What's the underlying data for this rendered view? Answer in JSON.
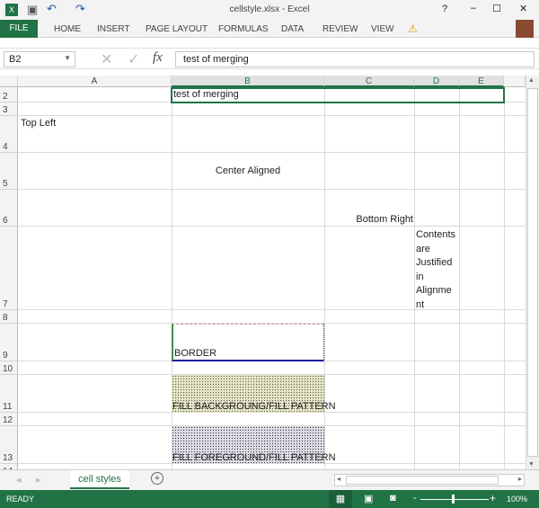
{
  "window": {
    "title": "cellstyle.xlsx - Excel",
    "help": "?",
    "minimize": "–",
    "maximize": "☐",
    "close": "✕"
  },
  "ribbon": {
    "tabs": [
      "FILE",
      "HOME",
      "INSERT",
      "PAGE LAYOUT",
      "FORMULAS",
      "DATA",
      "REVIEW",
      "VIEW"
    ],
    "warning": "⚠"
  },
  "formula_bar": {
    "name_box": "B2",
    "fx": "fx",
    "value": "test of merging"
  },
  "columns": [
    "A",
    "B",
    "C",
    "D",
    "E"
  ],
  "rows": [
    "2",
    "3",
    "4",
    "5",
    "6",
    "7",
    "8",
    "9",
    "10",
    "11",
    "12",
    "13",
    "14"
  ],
  "cells": {
    "B2": "test of merging",
    "A4": "Top Left",
    "B5": "Center Aligned",
    "C6": "Bottom Right",
    "D7": [
      "Contents",
      "are",
      "Justified",
      "in",
      "Alignme",
      "nt"
    ],
    "B9": "BORDER",
    "B11": "FILL BACKGROUNG/FILL PATTERN",
    "B13": "FILL FOREGROUND/FILL PATTERN"
  },
  "colors": {
    "accent": "#217346",
    "border_bottom": "#1a1aa0",
    "fill_background": "#d8d8b0",
    "fill_foreground": "#c8c8d8"
  },
  "sheets": [
    {
      "name": "cell styles",
      "active": true
    }
  ],
  "status": {
    "text": "READY",
    "zoom": "100%"
  }
}
